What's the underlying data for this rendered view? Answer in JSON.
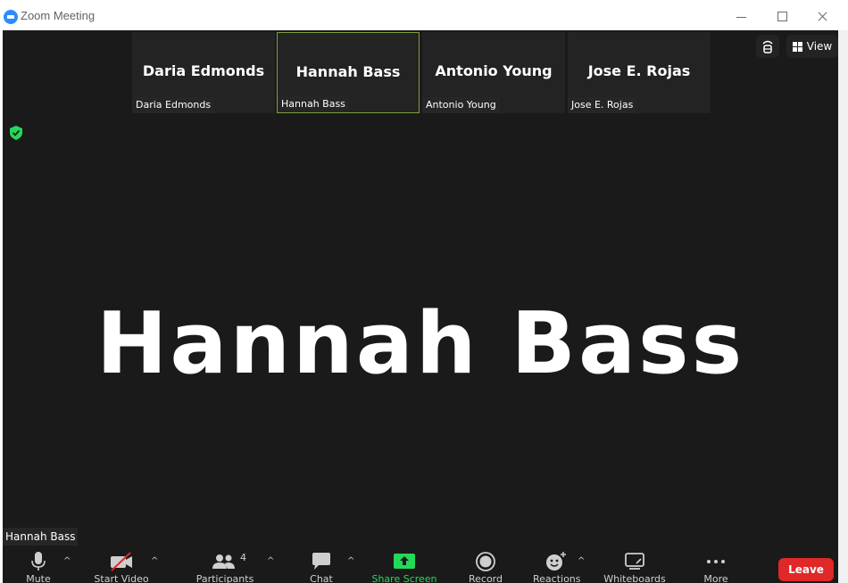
{
  "window": {
    "title": "Zoom Meeting"
  },
  "participants": [
    {
      "name": "Daria Edmonds",
      "label": "Daria Edmonds",
      "active": false
    },
    {
      "name": "Hannah Bass",
      "label": "Hannah Bass",
      "active": true
    },
    {
      "name": "Antonio Young",
      "label": "Antonio Young",
      "active": false
    },
    {
      "name": "Jose E. Rojas",
      "label": "Jose E. Rojas",
      "active": false
    }
  ],
  "main": {
    "speaker_name": "Hannah Bass",
    "self_label": "Hannah Bass"
  },
  "header": {
    "view_label": "View"
  },
  "toolbar": {
    "mute": "Mute",
    "start_video": "Start Video",
    "participants": "Participants",
    "participants_count": "4",
    "chat": "Chat",
    "share_screen": "Share Screen",
    "record": "Record",
    "reactions": "Reactions",
    "whiteboards": "Whiteboards",
    "more": "More",
    "leave": "Leave"
  },
  "colors": {
    "accent_green": "#23d959",
    "leave_red": "#e02828",
    "active_border": "#7e9f3a"
  }
}
